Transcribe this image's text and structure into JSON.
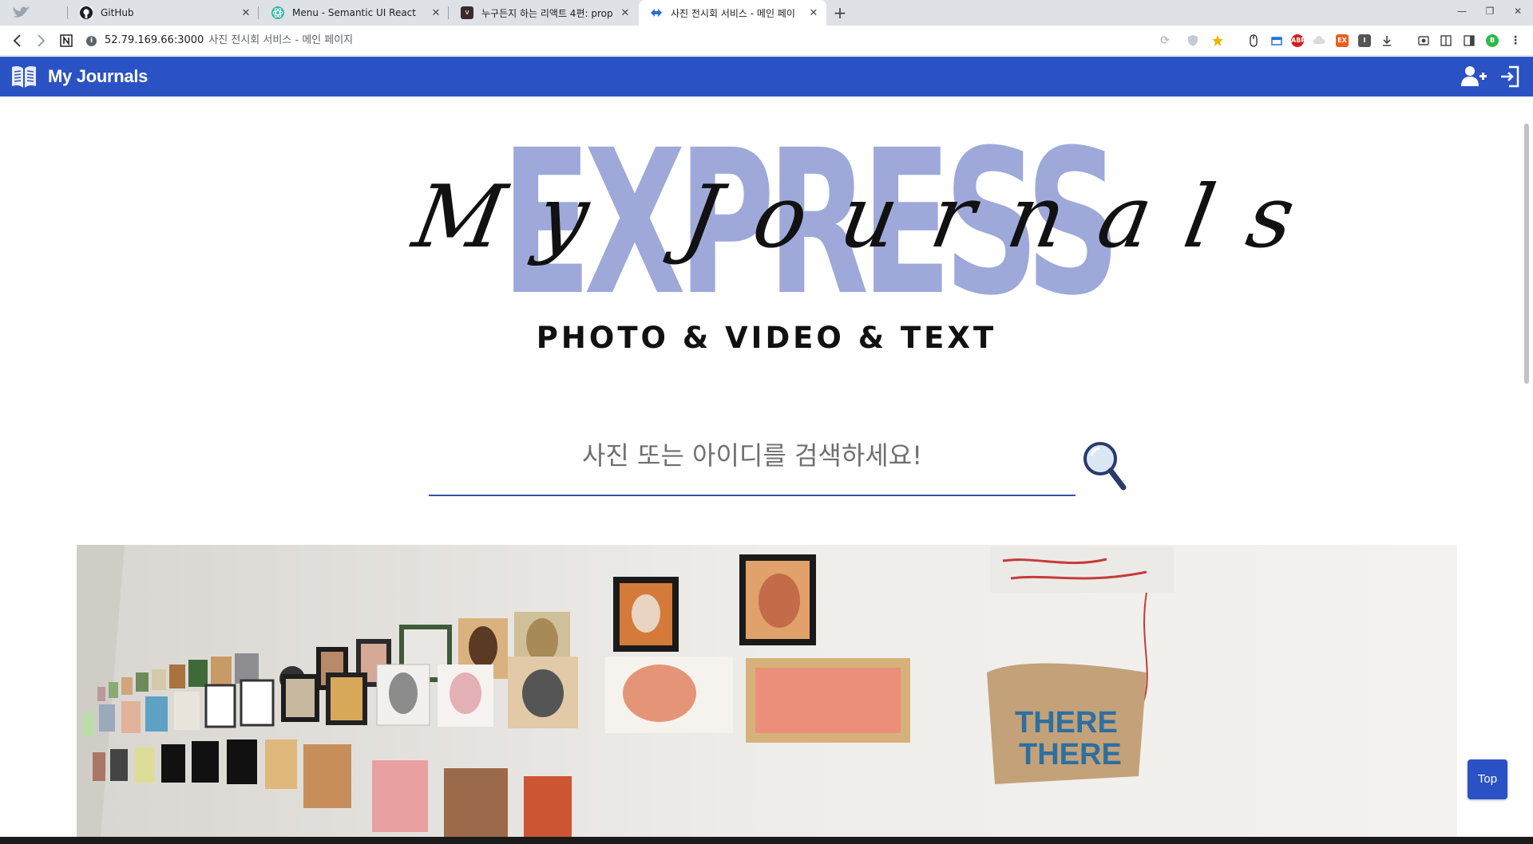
{
  "browser": {
    "tabs": [
      {
        "title": "",
        "icon": "twitter-icon"
      },
      {
        "title": "GitHub",
        "icon": "github-icon"
      },
      {
        "title": "Menu - Semantic UI React",
        "icon": "react-icon"
      },
      {
        "title": "누구든지 하는 리액트 4편: prop",
        "icon": "velopert-icon"
      },
      {
        "title": "사진 전시회 서비스 - 메인 페이",
        "icon": "app-icon"
      }
    ],
    "address": {
      "url": "52.79.169.66:3000",
      "page_title": "사진 전시회 서비스 - 메인 페이지"
    },
    "extensions": [
      "ABP",
      "EX"
    ],
    "profile_initial": "B"
  },
  "app": {
    "brand": "My Journals",
    "accent_color": "#2b52c4",
    "hero": {
      "big_word": "EXPRESS",
      "script_title": "My Journals",
      "tagline": "PHOTO & VIDEO & TEXT"
    },
    "search": {
      "placeholder": "사진 또는 아이디를 검색하세요!",
      "value": ""
    },
    "top_button": "Top"
  },
  "colors": {
    "appbar": "#2b52c4",
    "express": "#9ea9da",
    "search_underline": "#3352a8"
  }
}
